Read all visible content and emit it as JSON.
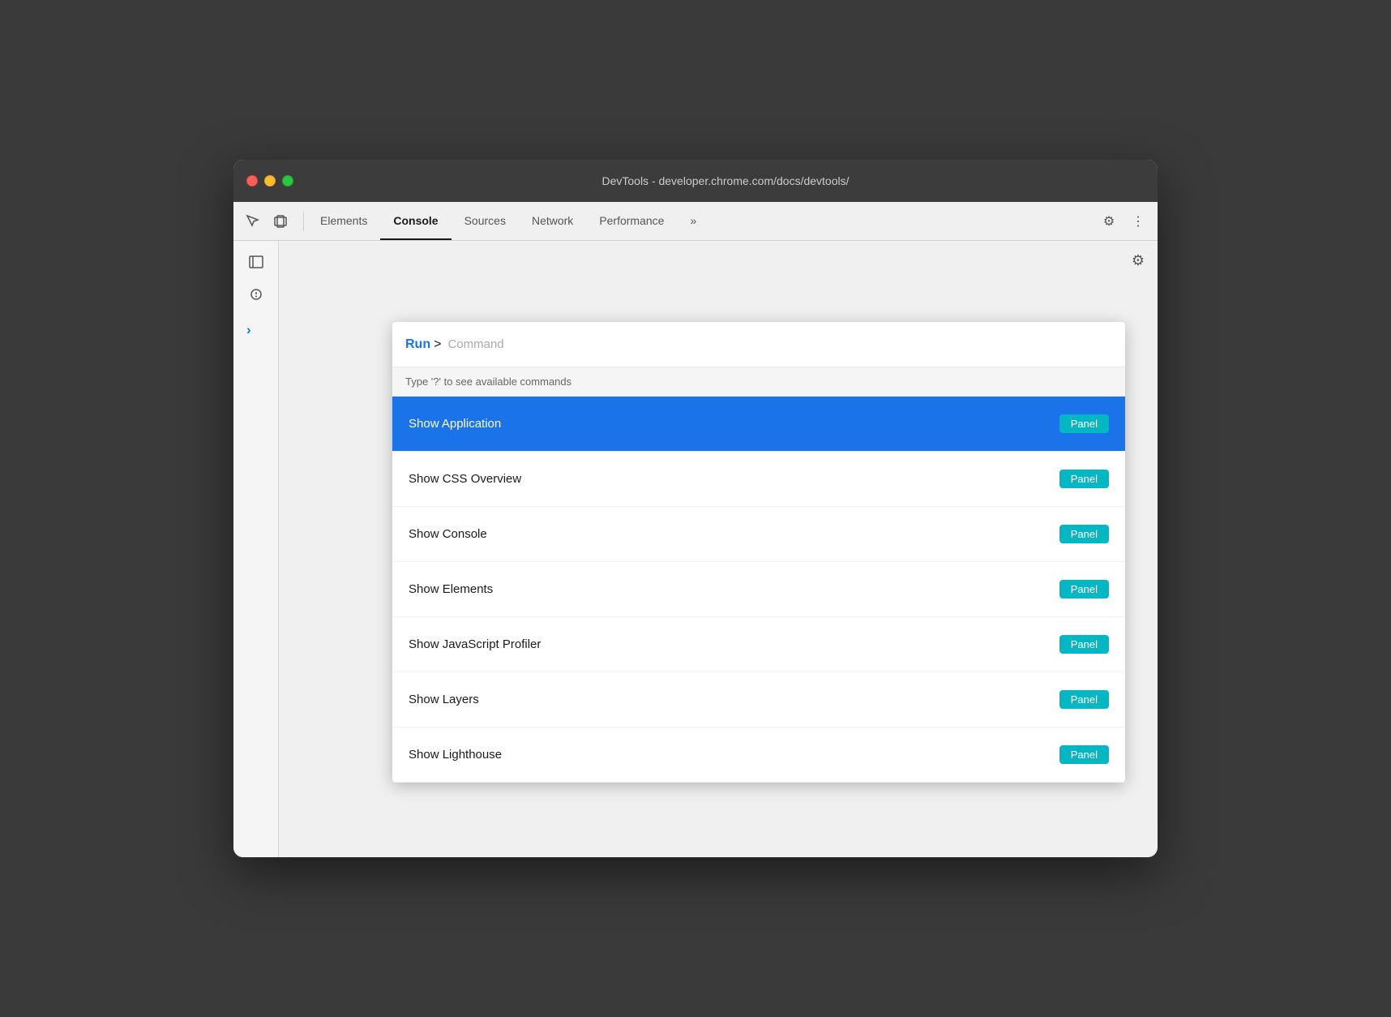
{
  "window": {
    "title": "DevTools - developer.chrome.com/docs/devtools/"
  },
  "titlebar": {
    "close": "close",
    "minimize": "minimize",
    "maximize": "maximize"
  },
  "tabs": [
    {
      "id": "elements",
      "label": "Elements",
      "active": false
    },
    {
      "id": "console",
      "label": "Console",
      "active": true
    },
    {
      "id": "sources",
      "label": "Sources",
      "active": false
    },
    {
      "id": "network",
      "label": "Network",
      "active": false
    },
    {
      "id": "performance",
      "label": "Performance",
      "active": false
    }
  ],
  "toolbar": {
    "more_tabs_label": "»",
    "settings_label": "⚙",
    "more_options_label": "⋮"
  },
  "sidebar": {
    "inspect_icon": "⬚",
    "device_icon": "⊡",
    "chevron_label": "›"
  },
  "command_palette": {
    "run_label": "Run",
    "arrow_label": ">",
    "input_placeholder": "Command",
    "hint_text": "Type '?' to see available commands",
    "items": [
      {
        "id": "show-application",
        "label": "Show Application",
        "badge": "Panel",
        "selected": true
      },
      {
        "id": "show-css-overview",
        "label": "Show CSS Overview",
        "badge": "Panel",
        "selected": false
      },
      {
        "id": "show-console",
        "label": "Show Console",
        "badge": "Panel",
        "selected": false
      },
      {
        "id": "show-elements",
        "label": "Show Elements",
        "badge": "Panel",
        "selected": false
      },
      {
        "id": "show-javascript-profiler",
        "label": "Show JavaScript Profiler",
        "badge": "Panel",
        "selected": false
      },
      {
        "id": "show-layers",
        "label": "Show Layers",
        "badge": "Panel",
        "selected": false
      },
      {
        "id": "show-lighthouse",
        "label": "Show Lighthouse",
        "badge": "Panel",
        "selected": false
      }
    ]
  },
  "colors": {
    "selected_bg": "#1a73e8",
    "badge_bg": "#00b8c4",
    "run_label": "#1a73e8",
    "chevron": "#1a73e8"
  }
}
